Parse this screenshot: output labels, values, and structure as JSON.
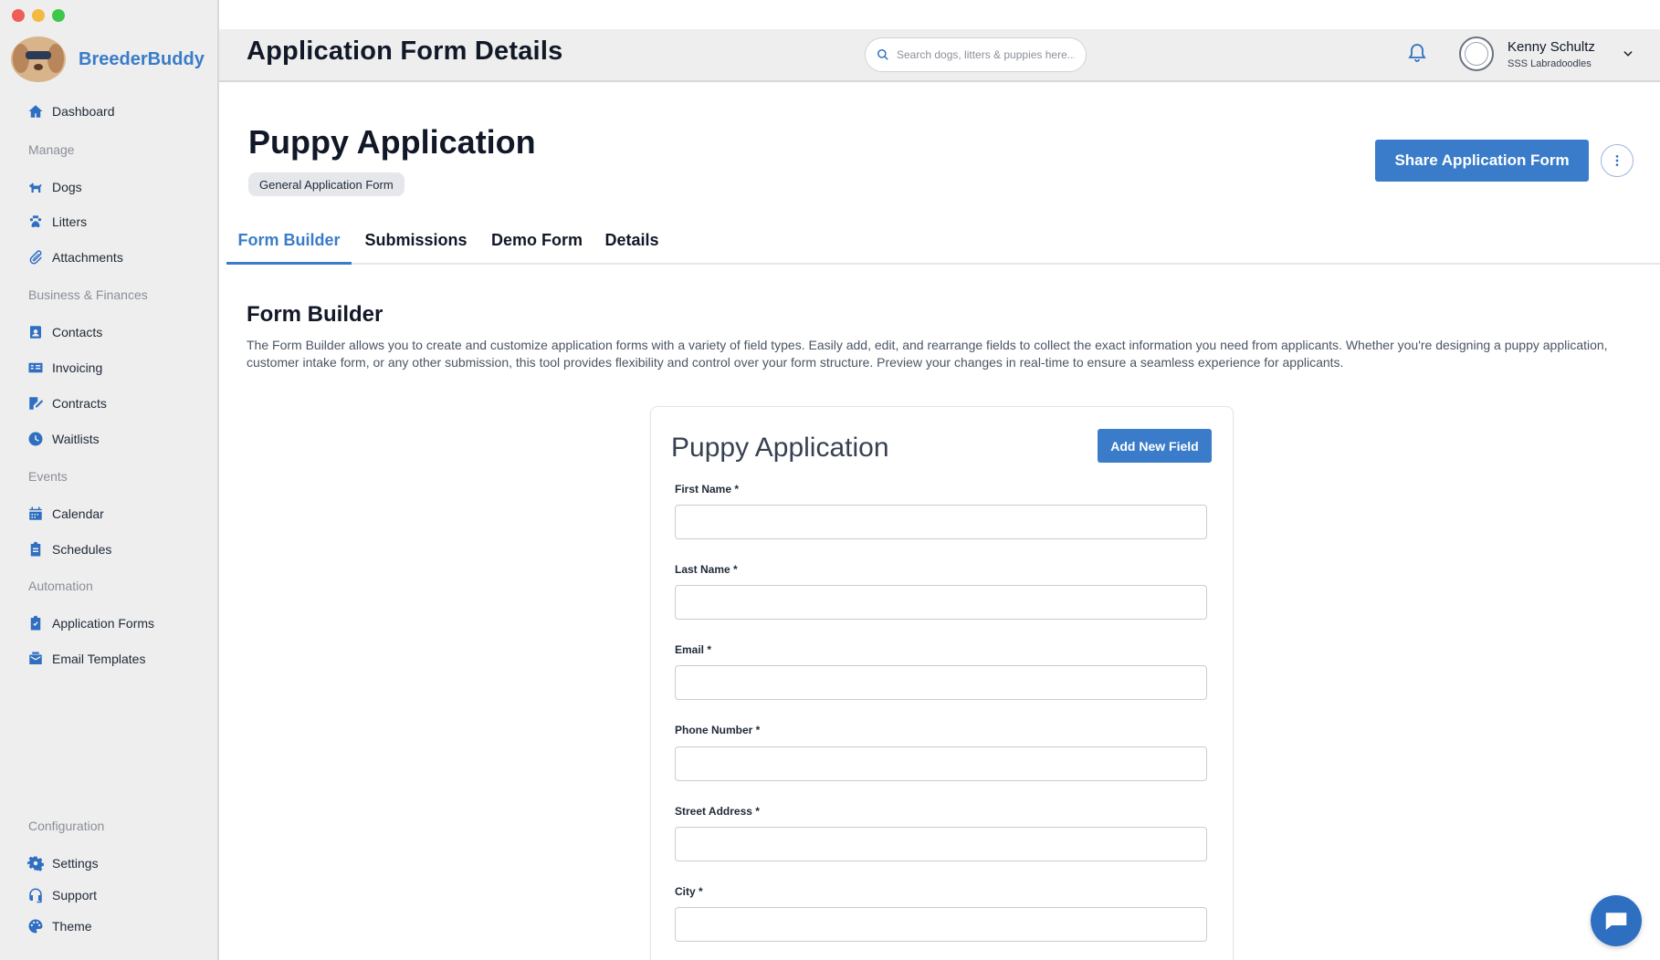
{
  "app": {
    "brand_name": "BreederBuddy",
    "accent_color": "#3a7cc9"
  },
  "sidebar": {
    "dashboard": "Dashboard",
    "sections": {
      "manage": "Manage",
      "business": "Business & Finances",
      "events": "Events",
      "automation": "Automation",
      "configuration": "Configuration"
    },
    "items": {
      "dogs": "Dogs",
      "litters": "Litters",
      "attachments": "Attachments",
      "contacts": "Contacts",
      "invoicing": "Invoicing",
      "contracts": "Contracts",
      "waitlists": "Waitlists",
      "calendar": "Calendar",
      "schedules": "Schedules",
      "application_forms": "Application Forms",
      "email_templates": "Email Templates",
      "settings": "Settings",
      "support": "Support",
      "theme": "Theme"
    }
  },
  "header": {
    "title": "Application Form Details",
    "search_placeholder": "Search dogs, litters & puppies here...",
    "user_name": "Kenny Schultz",
    "user_org": "SSS Labradoodles"
  },
  "page": {
    "title": "Puppy Application",
    "badge": "General Application Form",
    "share_button": "Share Application Form"
  },
  "tabs": [
    "Form Builder",
    "Submissions",
    "Demo Form",
    "Details"
  ],
  "form_builder": {
    "title": "Form Builder",
    "description": "The Form Builder allows you to create and customize application forms with a variety of field types. Easily add, edit, and rearrange fields to collect the exact information you need from applicants. Whether you're designing a puppy application, customer intake form, or any other submission, this tool provides flexibility and control over your form structure. Preview your changes in real-time to ensure a seamless experience for applicants.",
    "card_title": "Puppy Application",
    "add_button": "Add New Field",
    "fields": [
      {
        "label": "First Name *",
        "value": ""
      },
      {
        "label": "Last Name *",
        "value": ""
      },
      {
        "label": "Email *",
        "value": ""
      },
      {
        "label": "Phone Number *",
        "value": ""
      },
      {
        "label": "Street Address *",
        "value": ""
      },
      {
        "label": "City *",
        "value": ""
      }
    ]
  }
}
